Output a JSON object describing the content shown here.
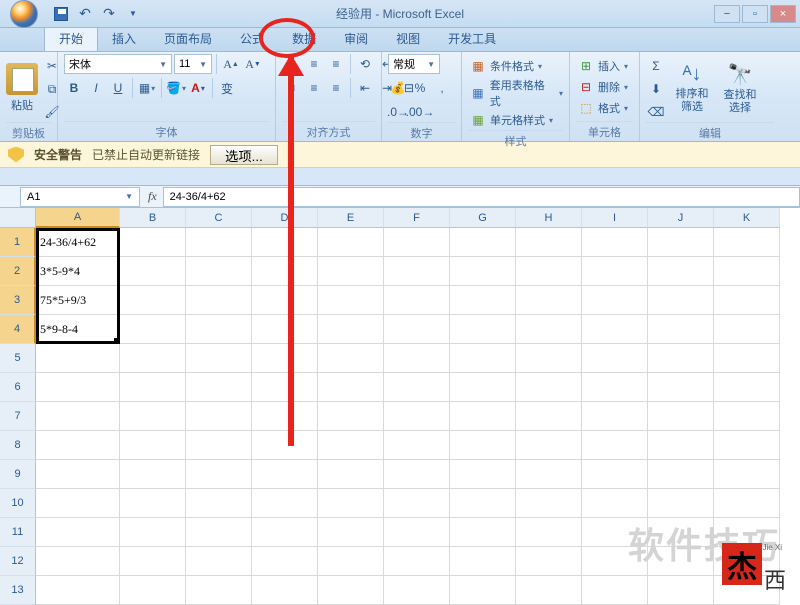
{
  "title": "经验用 - Microsoft Excel",
  "tabs": [
    "开始",
    "插入",
    "页面布局",
    "公式",
    "数据",
    "审阅",
    "视图",
    "开发工具"
  ],
  "active_tab": 0,
  "clipboard": {
    "paste": "粘贴",
    "label": "剪贴板"
  },
  "font": {
    "name": "宋体",
    "size": "11",
    "label": "字体"
  },
  "align": {
    "label": "对齐方式"
  },
  "number": {
    "format": "常规",
    "label": "数字"
  },
  "styles": {
    "cond": "条件格式",
    "table": "套用表格格式",
    "cell": "单元格样式",
    "label": "样式"
  },
  "cells": {
    "insert": "插入",
    "delete": "删除",
    "format": "格式",
    "label": "单元格"
  },
  "editing": {
    "sort": "排序和\n筛选",
    "find": "查找和\n选择",
    "label": "编辑"
  },
  "security": {
    "warn": "安全警告",
    "msg": "已禁止自动更新链接",
    "btn": "选项..."
  },
  "namebox": "A1",
  "formula": "24-36/4+62",
  "cols": [
    "A",
    "B",
    "C",
    "D",
    "E",
    "F",
    "G",
    "H",
    "I",
    "J",
    "K"
  ],
  "rows": [
    "1",
    "2",
    "3",
    "4",
    "5",
    "6",
    "7",
    "8",
    "9",
    "10",
    "11",
    "12",
    "13"
  ],
  "cells_data": {
    "A1": "24-36/4+62",
    "A2": "3*5-9*4",
    "A3": "75*5+9/3",
    "A4": "5*9-8-4"
  },
  "watermark": "软件技巧",
  "logo": {
    "jie": "杰",
    "xi": "西",
    "pin": "Jie Xi"
  }
}
